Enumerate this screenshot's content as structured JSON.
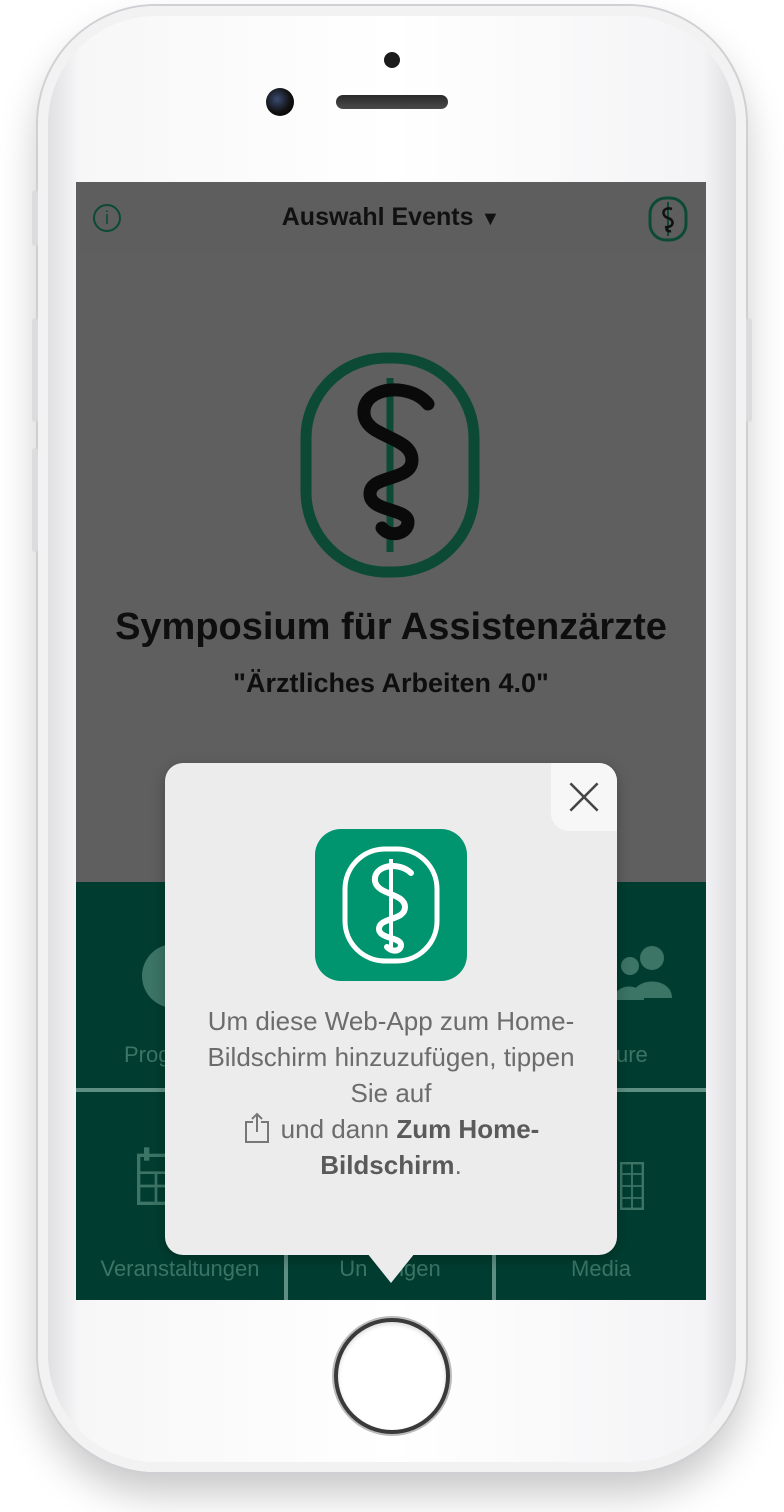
{
  "header": {
    "title": "Auswahl Events"
  },
  "hero": {
    "title": "Symposium für Assistenzärzte",
    "subtitle": "\"Ärztliches Arbeiten 4.0\""
  },
  "tiles": [
    {
      "label": "Prog",
      "icon": "program-icon"
    },
    {
      "label": "ure",
      "icon": "people-icon"
    },
    {
      "label": "Veranstaltungen",
      "icon": "calendar-icon"
    },
    {
      "label": "Un    ngen",
      "icon": "location-icon"
    },
    {
      "label": "Media",
      "icon": "media-icon"
    }
  ],
  "popup": {
    "line1": "Um diese Web-App zum Home-Bildschirm hinzuzufügen, tippen Sie auf",
    "line2_pre": "und dann ",
    "line2_bold": "Zum Home-Bildschirm",
    "line2_post": "."
  },
  "colors": {
    "brand_dark": "#003d30",
    "brand": "#00956e",
    "overlay": "#5f5f5f"
  }
}
